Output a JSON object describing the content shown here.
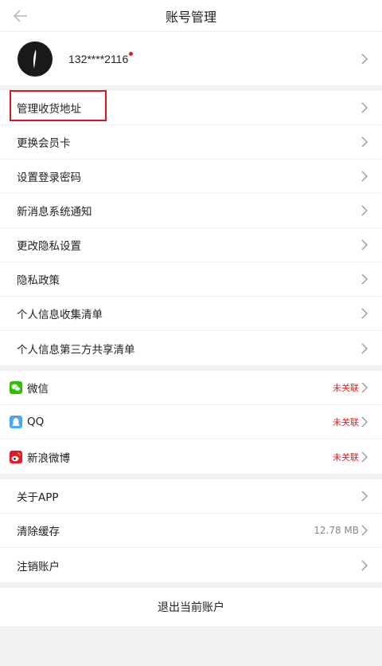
{
  "header": {
    "title": "账号管理",
    "back_icon": "arrow-left-icon"
  },
  "profile": {
    "phone": "132****2116",
    "avatar_icon": "avatar-logo-icon",
    "has_dot": true
  },
  "account_group": [
    {
      "key": "address",
      "label": "管理收货地址"
    },
    {
      "key": "member_card",
      "label": "更换会员卡"
    },
    {
      "key": "password",
      "label": "设置登录密码"
    },
    {
      "key": "notification",
      "label": "新消息系统通知"
    },
    {
      "key": "privacy_settings",
      "label": "更改隐私设置"
    },
    {
      "key": "privacy_policy",
      "label": "隐私政策"
    },
    {
      "key": "info_list",
      "label": "个人信息收集清单"
    },
    {
      "key": "third_party",
      "label": "个人信息第三方共享清单"
    }
  ],
  "social_group": [
    {
      "key": "wechat",
      "label": "微信",
      "status": "未关联",
      "icon": "wechat-icon",
      "color": "#2dc100"
    },
    {
      "key": "qq",
      "label": "QQ",
      "status": "未关联",
      "icon": "qq-icon",
      "color": "#4aa8f2"
    },
    {
      "key": "weibo",
      "label": "新浪微博",
      "status": "未关联",
      "icon": "weibo-icon",
      "color": "#e6162d"
    }
  ],
  "misc_group": [
    {
      "key": "about",
      "label": "关于APP",
      "value": ""
    },
    {
      "key": "cache",
      "label": "清除缓存",
      "value": "12.78 MB"
    },
    {
      "key": "deactivate",
      "label": "注销账户",
      "value": ""
    }
  ],
  "logout_label": "退出当前账户",
  "colors": {
    "accent_red": "#e02020",
    "background": "#f2f2f2"
  }
}
